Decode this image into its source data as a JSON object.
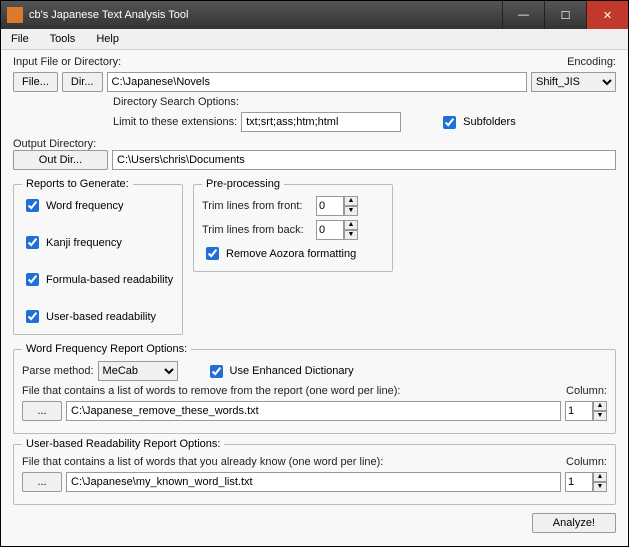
{
  "window": {
    "title": "cb's Japanese Text Analysis Tool"
  },
  "menu": {
    "file": "File",
    "tools": "Tools",
    "help": "Help"
  },
  "input": {
    "label": "Input File or Directory:",
    "file_btn": "File...",
    "dir_btn": "Dir...",
    "path": "C:\\Japanese\\Novels",
    "encoding_label": "Encoding:",
    "encoding_value": "Shift_JIS"
  },
  "dirsearch": {
    "legend": "Directory Search Options:",
    "limit_label": "Limit to these extensions:",
    "limit_value": "txt;srt;ass;htm;html",
    "subfolders": "Subfolders"
  },
  "output": {
    "label": "Output Directory:",
    "btn": "Out Dir...",
    "path": "C:\\Users\\chris\\Documents"
  },
  "reports": {
    "legend": "Reports to Generate:",
    "word_freq": "Word frequency",
    "kanji_freq": "Kanji frequency",
    "formula": "Formula-based readability",
    "user": "User-based readability"
  },
  "preproc": {
    "legend": "Pre-processing",
    "front_label": "Trim lines from front:",
    "front_value": "0",
    "back_label": "Trim lines from back:",
    "back_value": "0",
    "aozora": "Remove Aozora formatting"
  },
  "wfopts": {
    "legend": "Word Frequency Report Options:",
    "parse_label": "Parse method:",
    "parse_value": "MeCab",
    "enhanced": "Use Enhanced Dictionary",
    "remove_label": "File that contains a list of words to remove from the report (one word per line):",
    "browse": "...",
    "remove_path": "C:\\Japanese_remove_these_words.txt",
    "column_label": "Column:",
    "column_value": "1"
  },
  "ubopts": {
    "legend": "User-based Readability Report Options:",
    "known_label": "File that contains a list of words that you already know (one word per line):",
    "browse": "...",
    "known_path": "C:\\Japanese\\my_known_word_list.txt",
    "column_label": "Column:",
    "column_value": "1"
  },
  "analyze": "Analyze!"
}
